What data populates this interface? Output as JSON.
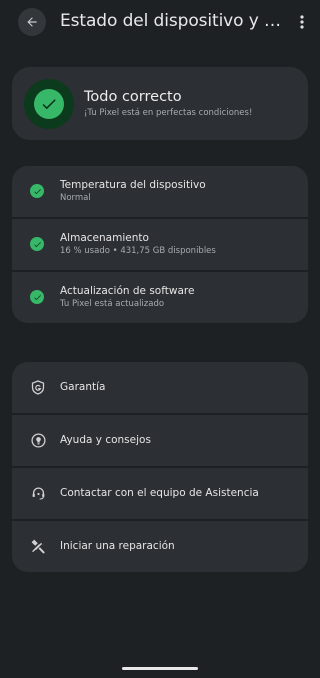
{
  "header": {
    "title": "Estado del dispositivo y asistencia",
    "back_icon": "arrow-back-icon",
    "more_icon": "more-vert-icon"
  },
  "summary": {
    "title": "Todo correcto",
    "subtitle": "¡Tu Pixel está en perfectas condiciones!",
    "icon": "check-circle-icon"
  },
  "status_items": [
    {
      "title": "Temperatura del dispositivo",
      "subtitle": "Normal",
      "icon": "check-icon"
    },
    {
      "title": "Almacenamiento",
      "subtitle": "16 % usado  •  431,75 GB disponibles",
      "icon": "check-icon"
    },
    {
      "title": "Actualización de software",
      "subtitle": "Tu Pixel está actualizado",
      "icon": "check-icon"
    }
  ],
  "support_items": [
    {
      "label": "Garantía",
      "icon": "shield-g-icon"
    },
    {
      "label": "Ayuda y consejos",
      "icon": "help-bulb-icon"
    },
    {
      "label": "Contactar con el equipo de Asistencia",
      "icon": "support-agent-icon"
    },
    {
      "label": "Iniciar una reparación",
      "icon": "tools-icon"
    }
  ],
  "colors": {
    "background": "#1e2124",
    "card": "#2c2f33",
    "accent_green": "#36b868"
  }
}
